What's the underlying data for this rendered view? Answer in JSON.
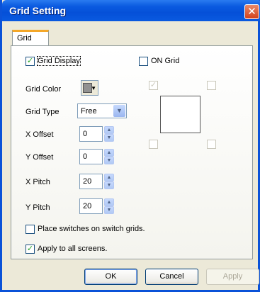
{
  "window": {
    "title": "Grid Setting"
  },
  "tabs": [
    {
      "label": "Grid"
    }
  ],
  "grid_display": {
    "label": "Grid Display",
    "checked": true
  },
  "on_grid": {
    "label": "ON Grid",
    "checked": false
  },
  "grid_color": {
    "label": "Grid Color",
    "value": "#919191"
  },
  "grid_type": {
    "label": "Grid Type",
    "value": "Free"
  },
  "x_offset": {
    "label": "X Offset",
    "value": "0"
  },
  "y_offset": {
    "label": "Y Offset",
    "value": "0"
  },
  "x_pitch": {
    "label": "X Pitch",
    "value": "20"
  },
  "y_pitch": {
    "label": "Y Pitch",
    "value": "20"
  },
  "place_switches": {
    "label": "Place switches on switch grids.",
    "checked": false
  },
  "apply_all": {
    "label": "Apply to all screens.",
    "checked": true
  },
  "buttons": {
    "ok": "OK",
    "cancel": "Cancel",
    "apply": "Apply"
  },
  "colors": {
    "title_bar": "#0a5ae0",
    "tab_accent": "#f4a728",
    "check_mark": "#21a121"
  }
}
